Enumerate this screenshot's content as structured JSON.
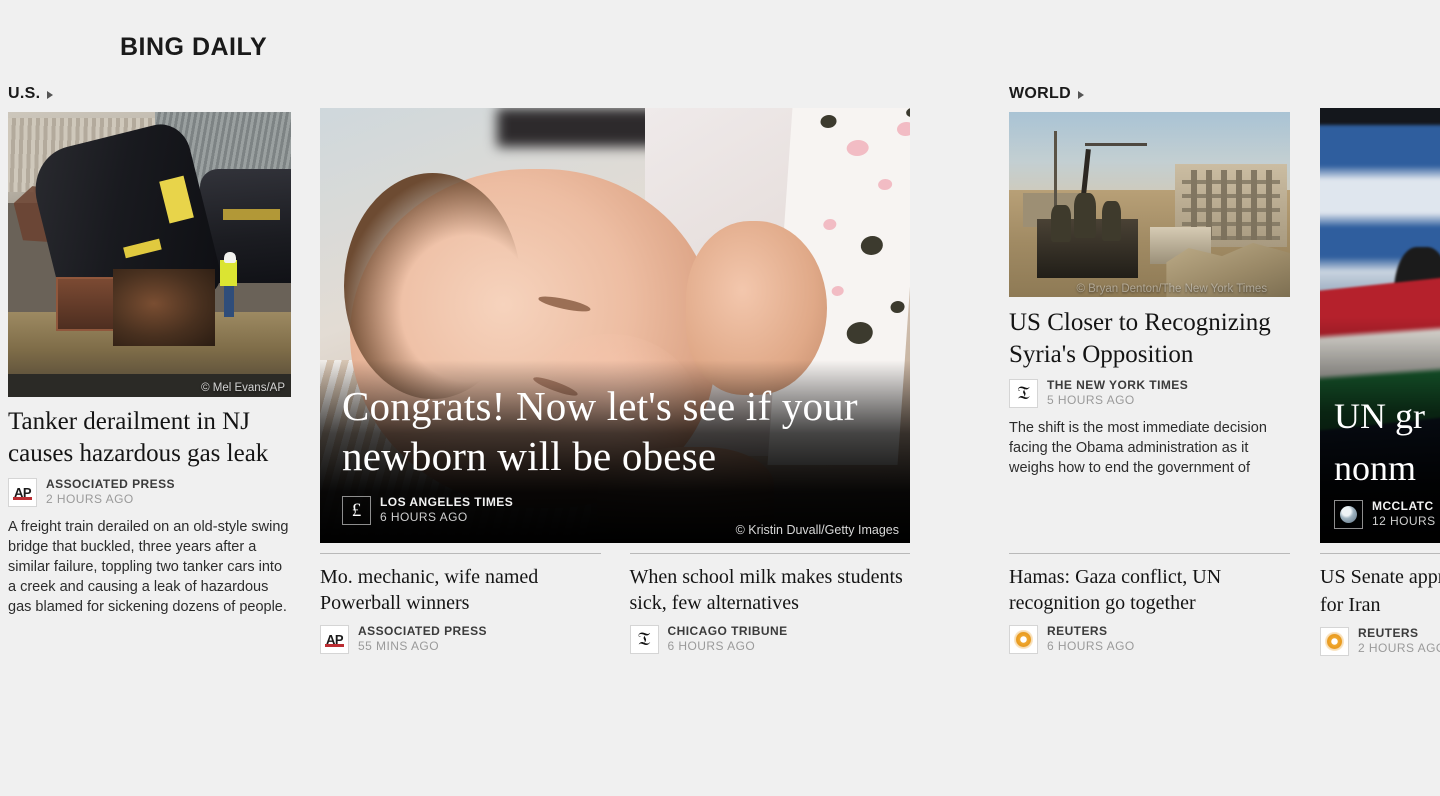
{
  "app": {
    "title": "BING DAILY"
  },
  "sections": {
    "us": {
      "label": "U.S.",
      "arrow": "▸"
    },
    "world": {
      "label": "WORLD",
      "arrow": "▸"
    }
  },
  "us_lead": {
    "title": "Tanker derailment in NJ causes hazardous gas leak",
    "source": "ASSOCIATED PRESS",
    "time": "2 HOURS AGO",
    "logo": "ap-logo-icon",
    "logo_text": "AP",
    "summary": "A freight train derailed on an old-style swing bridge that buckled, three years after a similar failure, toppling two tanker cars into a creek and causing a leak of hazardous gas blamed for sickening dozens of people.",
    "photo_credit": "© Mel Evans/AP"
  },
  "hero": {
    "title": "Congrats! Now let's see if your newborn will be obese",
    "source": "LOS ANGELES TIMES",
    "time": "6 HOURS AGO",
    "logo": "la-times-logo-icon",
    "logo_text": "£",
    "photo_credit": "© Kristin Duvall/Getty Images"
  },
  "hero_secondary": [
    {
      "title": "Mo. mechanic, wife named Powerball winners",
      "source": "ASSOCIATED PRESS",
      "time": "55 MINS AGO",
      "logo": "ap-logo-icon",
      "logo_text": "AP"
    },
    {
      "title": "When school milk makes students sick, few alternatives",
      "source": "CHICAGO TRIBUNE",
      "time": "6 HOURS AGO",
      "logo": "chicago-tribune-logo-icon",
      "logo_text": "𝔗"
    }
  ],
  "world_lead": {
    "title": "US Closer to Recognizing Syria's Opposition",
    "source": "THE NEW YORK TIMES",
    "time": "5 HOURS AGO",
    "logo": "nyt-logo-icon",
    "logo_text": "𝔗",
    "summary": "The shift is the most immediate decision facing the Obama administration as it weighs how to end the government of",
    "photo_credit": "© Bryan Denton/The New York Times"
  },
  "world_secondary": [
    {
      "title": "Hamas: Gaza conflict, UN recognition go together",
      "source": "REUTERS",
      "time": "6 HOURS AGO",
      "logo": "reuters-logo-icon"
    }
  ],
  "clipped_lead": {
    "title_line1": "UN gr",
    "title_line2": "nonm",
    "source": "MCCLATC",
    "time": "12 HOURS",
    "logo": "mcclatchy-logo-icon"
  },
  "clipped_secondary": [
    {
      "title_line1": "US Senate appr",
      "title_line2": "for Iran",
      "source": "REUTERS",
      "time": "2 HOURS AGO",
      "logo": "reuters-logo-icon"
    }
  ],
  "colors": {
    "page_bg": "#f0f0f0",
    "text_primary": "#141414",
    "text_muted": "#9a9a9a",
    "ap_red": "#bb2d32",
    "reuters_orange": "#e89a1e",
    "rule": "#b9b9b9"
  }
}
